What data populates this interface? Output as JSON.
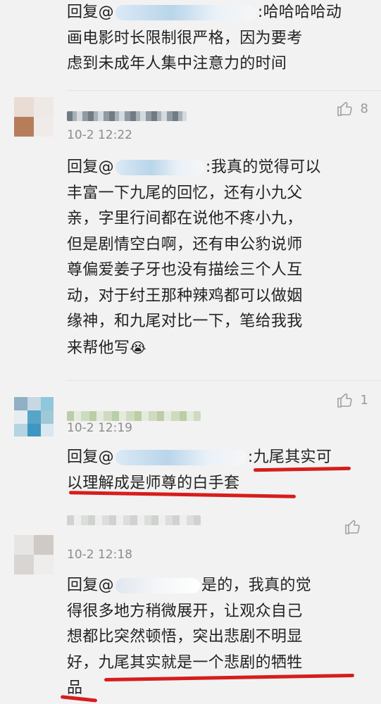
{
  "comments": [
    {
      "id": "c0",
      "reply_prefix": "回复@",
      "text_lines": [
        ":哈哈哈哈动",
        "画电影时长限制很严格，因为要考",
        "虑到未成年人集中注意力的时间"
      ]
    },
    {
      "id": "c1",
      "timestamp": "10-2 12:22",
      "likes": "8",
      "reply_prefix": "回复@",
      "text_lines": [
        ":我真的觉得可以",
        "丰富一下九尾的回忆，还有小九父",
        "亲，字里行间都在说他不疼小九，",
        "但是剧情空白啊，还有申公豹说师",
        "尊偏爱姜子牙也没有描绘三个人互",
        "动，对于纣王那种辣鸡都可以做姻",
        "缘神，和九尾对比一下，笔给我我",
        "来帮他写"
      ],
      "emoji": "😭"
    },
    {
      "id": "c2",
      "timestamp": "10-2 12:19",
      "likes": "1",
      "reply_prefix": "回复@",
      "text_lines": [
        ":九尾其实可",
        "以理解成是师尊的白手套"
      ]
    },
    {
      "id": "c3",
      "timestamp": "10-2 12:18",
      "likes": "",
      "reply_prefix": "回复@",
      "text_lines": [
        "是的，我真的觉",
        "得很多地方稍微展开，让观众自己",
        "想都比突然顿悟，突出悲剧不明显",
        "好，九尾其实就是一个悲剧的牺牲",
        "品"
      ]
    }
  ],
  "icons": {
    "like": "thumbs-up-icon"
  },
  "colors": {
    "annotation": "#d71d1d",
    "timestamp": "#8c8c8c",
    "background": "#f2f2f2"
  }
}
